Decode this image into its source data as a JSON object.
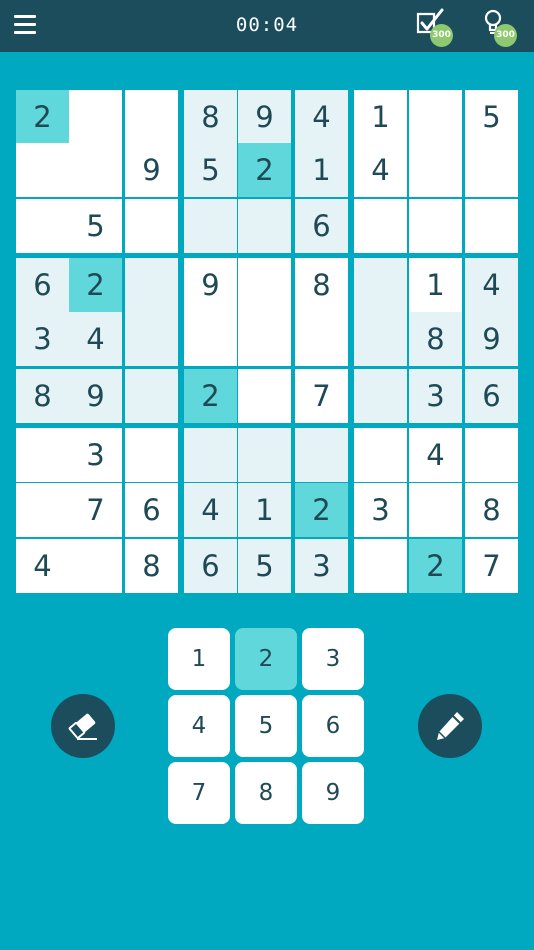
{
  "header": {
    "timer": "00:04",
    "check_badge": "300",
    "hint_badge": "300"
  },
  "icons": {
    "menu": "hamburger-menu-icon",
    "check": "check-icon",
    "hint": "lightbulb-icon",
    "eraser": "eraser-icon",
    "pencil": "pencil-icon"
  },
  "colors": {
    "background": "#00a9c0",
    "topbar": "#1b4d5c",
    "cell": "#ffffff",
    "highlight": "#e5f3f6",
    "same_number": "#5fd7db",
    "digit": "#1f4a55",
    "badge": "#8ec96f"
  },
  "board": {
    "cells": [
      [
        "2",
        "",
        "",
        "8",
        "9",
        "4",
        "1",
        "",
        "5"
      ],
      [
        "",
        "",
        "9",
        "5",
        "2",
        "1",
        "4",
        "",
        ""
      ],
      [
        "",
        "5",
        "",
        "",
        "",
        "6",
        "",
        "",
        ""
      ],
      [
        "6",
        "2",
        "",
        "9",
        "",
        "8",
        "",
        "1",
        "4"
      ],
      [
        "3",
        "4",
        "",
        "",
        "",
        "",
        "",
        "8",
        "9"
      ],
      [
        "8",
        "9",
        "",
        "2",
        "",
        "7",
        "",
        "3",
        "6"
      ],
      [
        "",
        "3",
        "",
        "",
        "",
        "",
        "",
        "4",
        ""
      ],
      [
        "",
        "7",
        "6",
        "4",
        "1",
        "2",
        "3",
        "",
        "8"
      ],
      [
        "4",
        "",
        "8",
        "6",
        "5",
        "3",
        "",
        "2",
        "7"
      ]
    ],
    "highlighted": [
      [
        0,
        3
      ],
      [
        0,
        4
      ],
      [
        0,
        5
      ],
      [
        1,
        3
      ],
      [
        1,
        5
      ],
      [
        2,
        3
      ],
      [
        2,
        4
      ],
      [
        2,
        5
      ],
      [
        3,
        0
      ],
      [
        3,
        2
      ],
      [
        3,
        6
      ],
      [
        3,
        8
      ],
      [
        4,
        0
      ],
      [
        4,
        1
      ],
      [
        4,
        2
      ],
      [
        4,
        6
      ],
      [
        4,
        7
      ],
      [
        4,
        8
      ],
      [
        5,
        0
      ],
      [
        5,
        1
      ],
      [
        5,
        2
      ],
      [
        5,
        6
      ],
      [
        5,
        7
      ],
      [
        5,
        8
      ],
      [
        6,
        3
      ],
      [
        6,
        4
      ],
      [
        6,
        5
      ],
      [
        7,
        3
      ],
      [
        7,
        4
      ],
      [
        8,
        3
      ],
      [
        8,
        4
      ],
      [
        8,
        5
      ]
    ],
    "selected_number": "2"
  },
  "numpad": {
    "keys": [
      "1",
      "2",
      "3",
      "4",
      "5",
      "6",
      "7",
      "8",
      "9"
    ],
    "active": "2"
  }
}
